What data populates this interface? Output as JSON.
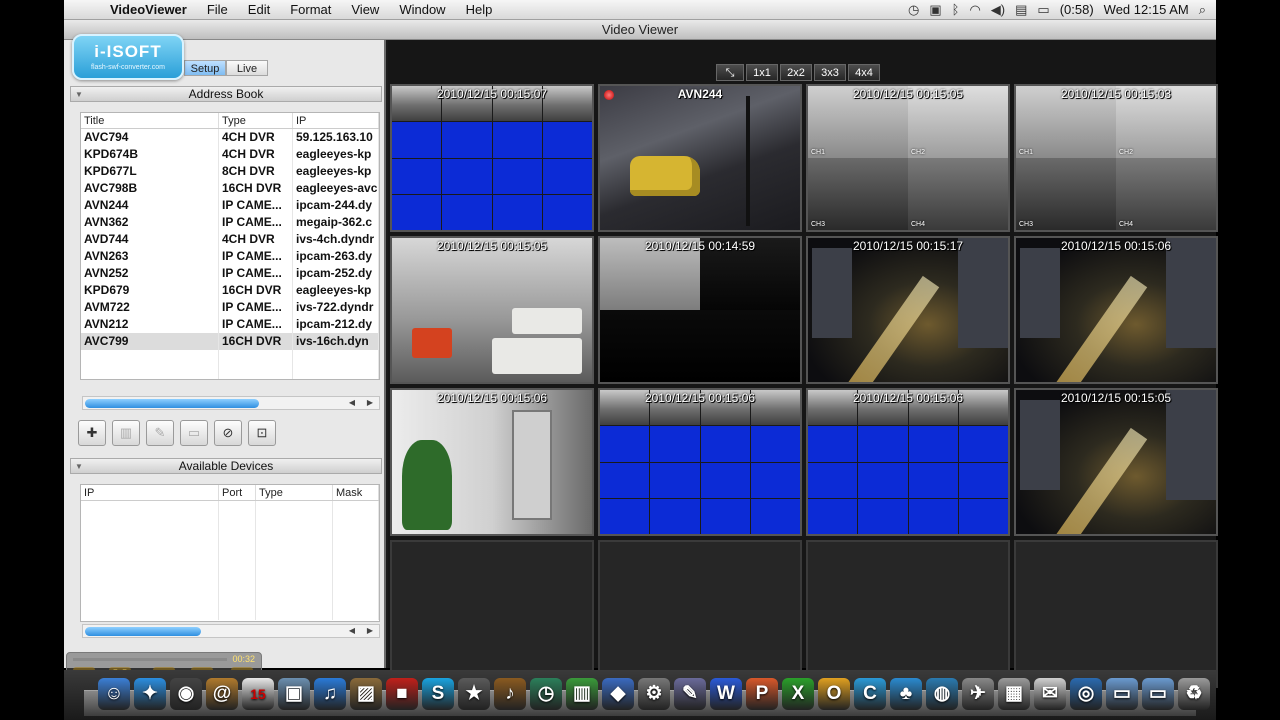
{
  "menubar": {
    "app_name": "VideoViewer",
    "items": [
      "File",
      "Edit",
      "Format",
      "View",
      "Window",
      "Help"
    ],
    "battery": "(0:58)",
    "clock": "Wed 12:15 AM"
  },
  "window": {
    "title": "Video Viewer"
  },
  "logo": {
    "brand": "i-ISOFT",
    "sub": "flash-swf-converter.com"
  },
  "mode_tabs": {
    "setup": "Setup",
    "live": "Live"
  },
  "address_book": {
    "header": "Address Book",
    "columns": [
      "Title",
      "Type",
      "IP"
    ],
    "rows": [
      [
        "AVC794",
        "4CH DVR",
        "59.125.163.10"
      ],
      [
        "KPD674B",
        "4CH DVR",
        "eagleeyes-kp"
      ],
      [
        "KPD677L",
        "8CH DVR",
        "eagleeyes-kp"
      ],
      [
        "AVC798B",
        "16CH DVR",
        "eagleeyes-avc"
      ],
      [
        "AVN244",
        "IP CAME...",
        "ipcam-244.dy"
      ],
      [
        "AVN362",
        "IP CAME...",
        "megaip-362.c"
      ],
      [
        "AVD744",
        "4CH DVR",
        "ivs-4ch.dyndr"
      ],
      [
        "AVN263",
        "IP CAME...",
        "ipcam-263.dy"
      ],
      [
        "AVN252",
        "IP CAME...",
        "ipcam-252.dy"
      ],
      [
        "KPD679",
        "16CH DVR",
        "eagleeyes-kp"
      ],
      [
        "AVM722",
        "IP CAME...",
        "ivs-722.dyndr"
      ],
      [
        "AVN212",
        "IP CAME...",
        "ipcam-212.dy"
      ],
      [
        "AVC799",
        "16CH DVR",
        "ivs-16ch.dyn"
      ]
    ],
    "selected_row": 12,
    "scroll_fraction": 0.6
  },
  "toolbar": {
    "buttons": [
      "add-device-icon",
      "trash-icon",
      "edit-icon",
      "connect-icon",
      "camera-off-icon",
      "lock-icon"
    ]
  },
  "available_devices": {
    "header": "Available Devices",
    "columns": [
      "IP",
      "Port",
      "Type",
      "Mask"
    ],
    "scroll_fraction": 0.4
  },
  "player": {
    "time": "00:32"
  },
  "layout_buttons": [
    "1x1",
    "2x2",
    "3x3",
    "4x4"
  ],
  "tiles": [
    {
      "label": "2010/12/15 00:15:07",
      "scene": "grid16"
    },
    {
      "label": "AVN244",
      "scene": "street",
      "recording": true
    },
    {
      "label": "2010/12/15 00:15:05",
      "scene": "quad-office",
      "quad_labels": [
        "CH1",
        "CH2",
        "CH3",
        "CH4"
      ]
    },
    {
      "label": "2010/12/15 00:15:03",
      "scene": "quad-office",
      "quad_labels": [
        "CH1",
        "CH2",
        "CH3",
        "CH4"
      ]
    },
    {
      "label": "2010/12/15 00:15:05",
      "scene": "lobby"
    },
    {
      "label": "2010/12/15 00:14:59",
      "scene": "quad-dark"
    },
    {
      "label": "2010/12/15 00:15:17",
      "scene": "night"
    },
    {
      "label": "2010/12/15 00:15:06",
      "scene": "night"
    },
    {
      "label": "2010/12/15 00:15:06",
      "scene": "hall"
    },
    {
      "label": "2010/12/15 00:15:06",
      "scene": "grid16"
    },
    {
      "label": "2010/12/15 00:15:06",
      "scene": "grid16"
    },
    {
      "label": "2010/12/15 00:15:05",
      "scene": "night"
    },
    {
      "label": "",
      "scene": "empty"
    },
    {
      "label": "",
      "scene": "empty"
    },
    {
      "label": "",
      "scene": "empty"
    },
    {
      "label": "",
      "scene": "empty"
    }
  ],
  "dock": {
    "icons": [
      {
        "name": "finder-icon",
        "glyph": "☺",
        "color": "#3b7fd6"
      },
      {
        "name": "safari-icon",
        "glyph": "✦",
        "color": "#2b8ee0"
      },
      {
        "name": "dashboard-icon",
        "glyph": "◉",
        "color": "#444"
      },
      {
        "name": "address-book-icon",
        "glyph": "@",
        "color": "#b07a2d"
      },
      {
        "name": "calendar-icon",
        "glyph": "15",
        "color": "#e8e8e8"
      },
      {
        "name": "preview-icon",
        "glyph": "▣",
        "color": "#6b8fb0"
      },
      {
        "name": "itunes-icon",
        "glyph": "♫",
        "color": "#2a7ad8"
      },
      {
        "name": "iphoto-icon",
        "glyph": "▨",
        "color": "#8a6a3a"
      },
      {
        "name": "photobooth-icon",
        "glyph": "■",
        "color": "#c0201a"
      },
      {
        "name": "skype-icon",
        "glyph": "S",
        "color": "#19a3e0"
      },
      {
        "name": "imovie-icon",
        "glyph": "★",
        "color": "#5a5a5a"
      },
      {
        "name": "garageband-icon",
        "glyph": "♪",
        "color": "#8a5a20"
      },
      {
        "name": "timemachine-icon",
        "glyph": "◷",
        "color": "#2b7f5a"
      },
      {
        "name": "numbers-icon",
        "glyph": "▥",
        "color": "#3a9a3a"
      },
      {
        "name": "keynote-icon",
        "glyph": "◆",
        "color": "#3a6ac0"
      },
      {
        "name": "system-prefs-icon",
        "glyph": "⚙",
        "color": "#777"
      },
      {
        "name": "utilities-icon",
        "glyph": "✎",
        "color": "#6a6a9a"
      },
      {
        "name": "word-icon",
        "glyph": "W",
        "color": "#2a5ad8"
      },
      {
        "name": "powerpoint-icon",
        "glyph": "P",
        "color": "#d8582a"
      },
      {
        "name": "excel-icon",
        "glyph": "X",
        "color": "#2aa02a"
      },
      {
        "name": "outlook-icon",
        "glyph": "O",
        "color": "#e0a020"
      },
      {
        "name": "messenger-icon",
        "glyph": "C",
        "color": "#2a9ad8"
      },
      {
        "name": "people-icon",
        "glyph": "♣",
        "color": "#2a8ad0"
      },
      {
        "name": "globe-icon",
        "glyph": "◍",
        "color": "#2a7ab0"
      },
      {
        "name": "network-icon",
        "glyph": "✈",
        "color": "#888"
      },
      {
        "name": "archive-icon",
        "glyph": "▦",
        "color": "#9a9a9a"
      },
      {
        "name": "notes-icon",
        "glyph": "✉",
        "color": "#d0d0d0"
      },
      {
        "name": "video-viewer-icon",
        "glyph": "◎",
        "color": "#2a6ab0"
      },
      {
        "name": "applications-folder-icon",
        "glyph": "▭",
        "color": "#6a9ad0"
      },
      {
        "name": "documents-folder-icon",
        "glyph": "▭",
        "color": "#6a9ad0"
      },
      {
        "name": "trash-dock-icon",
        "glyph": "♻",
        "color": "#9a9a9a"
      }
    ]
  }
}
